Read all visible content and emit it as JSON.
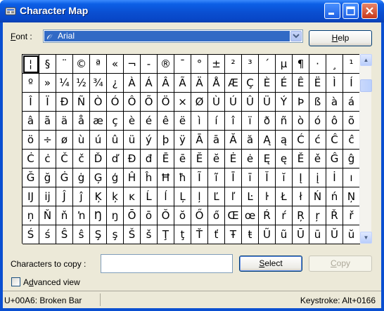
{
  "window": {
    "title": "Character Map"
  },
  "font": {
    "label_prefix": "F",
    "label_rest": "ont :",
    "value": "Arial",
    "icon": "truetype-icon"
  },
  "help_button": {
    "label": "Help",
    "accel": "H",
    "rest": "elp"
  },
  "grid": {
    "rows": [
      [
        "¦",
        "§",
        "¨",
        "©",
        "ª",
        "«",
        "¬",
        "-",
        "®",
        "¯",
        "°",
        "±",
        "²",
        "³",
        "´",
        "µ",
        "¶",
        "·",
        "¸",
        "¹"
      ],
      [
        "º",
        "»",
        "¼",
        "½",
        "¾",
        "¿",
        "À",
        "Á",
        "Â",
        "Ã",
        "Ä",
        "Å",
        "Æ",
        "Ç",
        "È",
        "É",
        "Ê",
        "Ë",
        "Ì",
        "Í"
      ],
      [
        "Î",
        "Ï",
        "Ð",
        "Ñ",
        "Ò",
        "Ó",
        "Ô",
        "Õ",
        "Ö",
        "×",
        "Ø",
        "Ù",
        "Ú",
        "Û",
        "Ü",
        "Ý",
        "Þ",
        "ß",
        "à",
        "á"
      ],
      [
        "â",
        "ã",
        "ä",
        "å",
        "æ",
        "ç",
        "è",
        "é",
        "ê",
        "ë",
        "ì",
        "í",
        "î",
        "ï",
        "ð",
        "ñ",
        "ò",
        "ó",
        "ô",
        "õ"
      ],
      [
        "ö",
        "÷",
        "ø",
        "ù",
        "ú",
        "û",
        "ü",
        "ý",
        "þ",
        "ÿ",
        "Ā",
        "ā",
        "Ă",
        "ă",
        "Ą",
        "ą",
        "Ć",
        "ć",
        "Ĉ",
        "ĉ"
      ],
      [
        "Ċ",
        "ċ",
        "Č",
        "č",
        "Ď",
        "ď",
        "Đ",
        "đ",
        "Ē",
        "ē",
        "Ĕ",
        "ĕ",
        "Ė",
        "ė",
        "Ę",
        "ę",
        "Ě",
        "ě",
        "Ĝ",
        "ĝ"
      ],
      [
        "Ğ",
        "ğ",
        "Ġ",
        "ġ",
        "Ģ",
        "ģ",
        "Ĥ",
        "ĥ",
        "Ħ",
        "ħ",
        "Ĩ",
        "ĩ",
        "Ī",
        "ī",
        "Ĭ",
        "ĭ",
        "Į",
        "į",
        "İ",
        "ı"
      ],
      [
        "Ĳ",
        "ĳ",
        "Ĵ",
        "ĵ",
        "Ķ",
        "ķ",
        "ĸ",
        "Ĺ",
        "ĺ",
        "Ļ",
        "ļ",
        "Ľ",
        "ľ",
        "Ŀ",
        "ŀ",
        "Ł",
        "ł",
        "Ń",
        "ń",
        "Ņ"
      ],
      [
        "ņ",
        "Ň",
        "ň",
        "ŉ",
        "Ŋ",
        "ŋ",
        "Ō",
        "ō",
        "Ŏ",
        "ŏ",
        "Ő",
        "ő",
        "Œ",
        "œ",
        "Ŕ",
        "ŕ",
        "Ŗ",
        "ŗ",
        "Ř",
        "ř"
      ],
      [
        "Ś",
        "ś",
        "Ŝ",
        "ŝ",
        "Ş",
        "ş",
        "Š",
        "š",
        "Ţ",
        "ţ",
        "Ť",
        "ť",
        "Ŧ",
        "ŧ",
        "Ũ",
        "ũ",
        "Ū",
        "ū",
        "Ŭ",
        "ŭ"
      ]
    ],
    "selected": "¦"
  },
  "copy": {
    "label": "Characters to copy :",
    "value": ""
  },
  "select_button": {
    "label": "Select",
    "accel": "S",
    "rest": "elect"
  },
  "copy_button": {
    "label": "Copy",
    "accel": "C",
    "rest": "opy"
  },
  "advanced": {
    "label": "Advanced view",
    "accel": "d",
    "pre": "A",
    "post": "vanced view",
    "checked": false
  },
  "status": {
    "left": "U+00A6: Broken Bar",
    "right": "Keystroke: Alt+0166"
  }
}
